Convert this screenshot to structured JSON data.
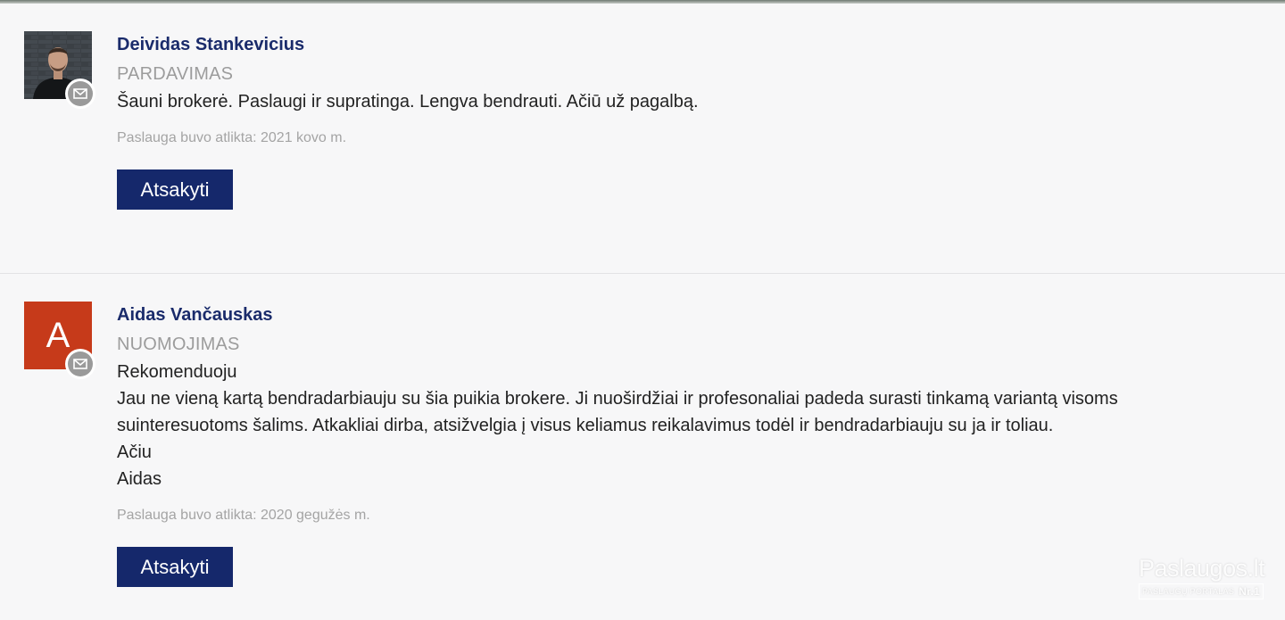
{
  "reviews": [
    {
      "name": "Deividas Stankevicius",
      "category": "PARDAVIMAS",
      "text_lines": [
        "Šauni brokerė. Paslaugi ir supratinga. Lengva bendrauti. Ačiū už pagalbą."
      ],
      "date": "Paslauga buvo atlikta: 2021 kovo m.",
      "reply_label": "Atsakyti"
    },
    {
      "name": "Aidas Vančauskas",
      "avatar_letter": "A",
      "category": "NUOMOJIMAS",
      "text_lines": [
        "Rekomenduoju",
        "Jau ne vieną kartą bendradarbiauju su šia puikia brokere. Ji nuoširdžiai ir profesonaliai padeda surasti tinkamą variantą visoms",
        "suinteresuotoms šalims. Atkakliai dirba, atsižvelgia į visus keliamus reikalavimus todėl ir bendradarbiauju su ja ir toliau.",
        "Ačiu",
        "Aidas"
      ],
      "date": "Paslauga buvo atlikta: 2020 gegužės m.",
      "reply_label": "Atsakyti"
    }
  ],
  "watermark": {
    "title": "Paslaugos.lt",
    "subtitle": "PASLAUGŲ PORTALAS",
    "badge": "Nr.1"
  },
  "colors": {
    "name": "#1a2b6b",
    "button": "#15286b",
    "avatar_letter_bg": "#c63a1a",
    "category": "#9c9c9c"
  },
  "icons": [
    "mail-icon",
    "user-photo"
  ]
}
